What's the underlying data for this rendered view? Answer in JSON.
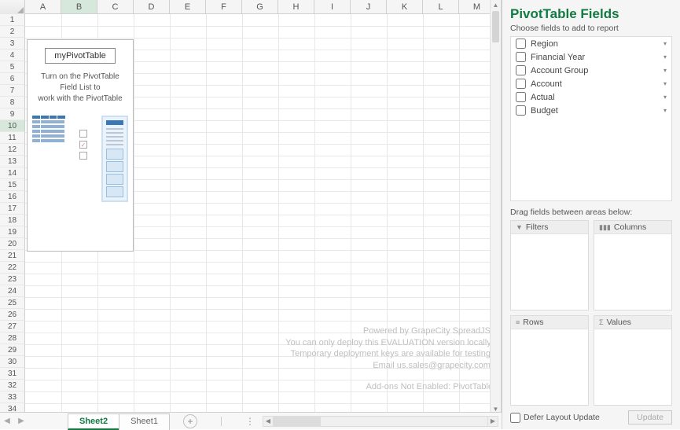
{
  "grid": {
    "columns": [
      "A",
      "B",
      "C",
      "D",
      "E",
      "F",
      "G",
      "H",
      "I",
      "J",
      "K",
      "L",
      "M"
    ],
    "row_count": 34,
    "selected_column": "B",
    "active_row": 10,
    "pivot_placeholder": {
      "title": "myPivotTable",
      "hint_line1": "Turn on the PivotTable Field List to",
      "hint_line2": "work with the PivotTable"
    },
    "watermark": {
      "l1": "Powered by GrapeCity SpreadJS.",
      "l2": "You can only deploy this EVALUATION version locally.",
      "l3": "Temporary deployment keys are available for testing.",
      "l4": "Email us.sales@grapecity.com.",
      "l5": "Add-ons Not Enabled: PivotTable"
    }
  },
  "tabs": {
    "active": "Sheet2",
    "others": [
      "Sheet1"
    ]
  },
  "panel": {
    "title": "PivotTable Fields",
    "subtitle": "Choose fields to add to report",
    "fields": [
      "Region",
      "Financial Year",
      "Account Group",
      "Account",
      "Actual",
      "Budget"
    ],
    "drag_label": "Drag fields between areas below:",
    "areas": {
      "filters": "Filters",
      "columns": "Columns",
      "rows": "Rows",
      "values": "Values"
    },
    "defer_label": "Defer Layout Update",
    "update_btn": "Update"
  }
}
